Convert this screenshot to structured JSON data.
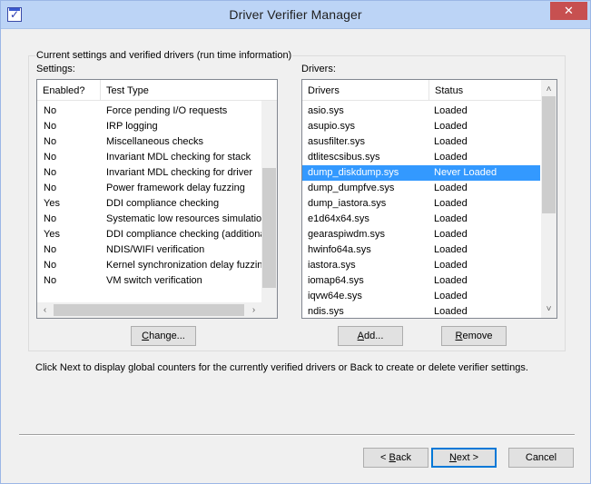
{
  "window": {
    "title": "Driver Verifier Manager",
    "close_glyph": "✕"
  },
  "group": {
    "legend": "Current settings and verified drivers (run time information)"
  },
  "settings": {
    "label": "Settings:",
    "columns": [
      "Enabled?",
      "Test Type"
    ],
    "rows": [
      {
        "enabled": "No",
        "test": "Force pending I/O requests"
      },
      {
        "enabled": "No",
        "test": "IRP logging"
      },
      {
        "enabled": "No",
        "test": "Miscellaneous checks"
      },
      {
        "enabled": "No",
        "test": "Invariant MDL checking for stack"
      },
      {
        "enabled": "No",
        "test": "Invariant MDL checking for driver"
      },
      {
        "enabled": "No",
        "test": "Power framework delay fuzzing"
      },
      {
        "enabled": "Yes",
        "test": "DDI compliance checking"
      },
      {
        "enabled": "No",
        "test": "Systematic low resources simulation"
      },
      {
        "enabled": "Yes",
        "test": "DDI compliance checking (additional)"
      },
      {
        "enabled": "No",
        "test": "NDIS/WIFI verification"
      },
      {
        "enabled": "No",
        "test": "Kernel synchronization delay fuzzing"
      },
      {
        "enabled": "No",
        "test": "VM switch verification"
      }
    ],
    "change_button": {
      "pre": "",
      "u": "C",
      "post": "hange..."
    }
  },
  "drivers": {
    "label": "Drivers:",
    "columns": [
      "Drivers",
      "Status"
    ],
    "rows": [
      {
        "name": "asio.sys",
        "status": "Loaded"
      },
      {
        "name": "asupio.sys",
        "status": "Loaded"
      },
      {
        "name": "asusfilter.sys",
        "status": "Loaded"
      },
      {
        "name": "dtlitescsibus.sys",
        "status": "Loaded"
      },
      {
        "name": "dump_diskdump.sys",
        "status": "Never Loaded"
      },
      {
        "name": "dump_dumpfve.sys",
        "status": "Loaded"
      },
      {
        "name": "dump_iastora.sys",
        "status": "Loaded"
      },
      {
        "name": "e1d64x64.sys",
        "status": "Loaded"
      },
      {
        "name": "gearaspiwdm.sys",
        "status": "Loaded"
      },
      {
        "name": "hwinfo64a.sys",
        "status": "Loaded"
      },
      {
        "name": "iastora.sys",
        "status": "Loaded"
      },
      {
        "name": "iomap64.sys",
        "status": "Loaded"
      },
      {
        "name": "iqvw64e.sys",
        "status": "Loaded"
      },
      {
        "name": "ndis.sys",
        "status": "Loaded"
      }
    ],
    "selected_index": 4,
    "add_button": {
      "pre": "",
      "u": "A",
      "post": "dd..."
    },
    "remove_button": {
      "pre": "",
      "u": "R",
      "post": "emove"
    }
  },
  "hint": "Click Next to display global counters for the currently verified drivers or Back to create or delete verifier settings.",
  "footer": {
    "back": {
      "pre": "< ",
      "u": "B",
      "post": "ack"
    },
    "next": {
      "pre": "",
      "u": "N",
      "post": "ext >"
    },
    "cancel": "Cancel"
  },
  "icons": {
    "scroll_up": "˄",
    "scroll_down": "˅",
    "scroll_left": "‹",
    "scroll_right": "›"
  }
}
